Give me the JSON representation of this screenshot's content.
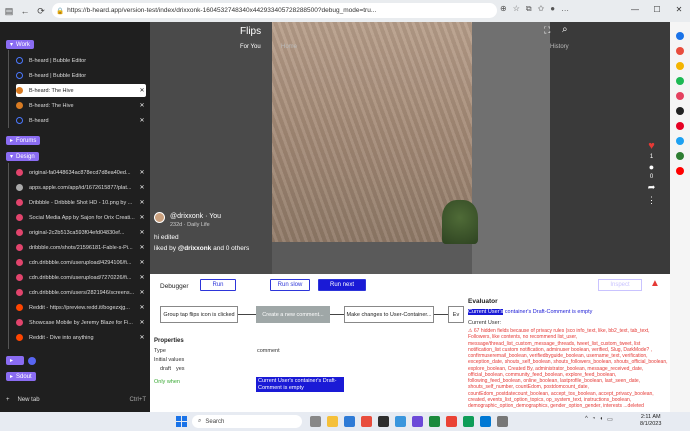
{
  "browser": {
    "url": "https://b-heard.app/version-test/index/drixxonk-1604532748340x442933405728288500?debug_mode=tru..."
  },
  "sidebar": {
    "groups": [
      {
        "label": "Work",
        "color": "#8a6cf2"
      },
      {
        "label": "Forums",
        "color": "#8a6cf2"
      },
      {
        "label": "Design",
        "color": "#8a6cf2"
      },
      {
        "label": "Sdout",
        "color": "#8a6cf2"
      }
    ],
    "work_tabs": [
      {
        "label": "B-heard | Bubble Editor"
      },
      {
        "label": "B-heard | Bubble Editor"
      },
      {
        "label": "B-heard: The Hive",
        "active": true
      },
      {
        "label": "B-heard: The Hive"
      },
      {
        "label": "B-heard"
      }
    ],
    "design_tabs": [
      {
        "label": "original-fa0448634ac878ecd7d8ea40ed..."
      },
      {
        "label": "apps.apple.com/app/id/1672615877/plat..."
      },
      {
        "label": "Dribbble - Dribbble Shot HD - 10.png by ..."
      },
      {
        "label": "Social Media App by Sajon for Orix Creati..."
      },
      {
        "label": "original-2c2b513ca593f04efd04830ef..."
      },
      {
        "label": "dribbble.com/shots/21596181-Fable-s-Pi..."
      },
      {
        "label": "cdn.dribbble.com/userupload/4294106/fi..."
      },
      {
        "label": "cdn.dribbble.com/userupload/7270226/fi..."
      },
      {
        "label": "cdn.dribbble.com/users/2821946/screens..."
      },
      {
        "label": "Reddit - https://preview.redd.it/bogezxjg..."
      },
      {
        "label": "Showcase Mobile by Jeremy Blaze for Fi..."
      },
      {
        "label": "Reddit - Dive into anything"
      }
    ],
    "new_tab": {
      "label": "New tab",
      "shortcut": "Ctrl+T"
    }
  },
  "video": {
    "title": "Flips",
    "tabs": {
      "for_you": "For You",
      "home": "Home",
      "history": "History"
    },
    "user": "@drixxonk · You",
    "sub": "232d · Daily Life",
    "caption": "hi edited",
    "liked_prefix": "liked by ",
    "liked_user": "@drixxonk",
    "liked_suffix": " and 0 others",
    "like_count": "1",
    "comment_count": "0"
  },
  "debugger": {
    "title": "Debugger",
    "run": "Run",
    "run_slow": "Run slow",
    "run_next": "Run next",
    "inspect": "Inspect",
    "steps": [
      "Group tap flips icon is clicked",
      "Create a new comment...",
      "Make changes to User-Container...",
      "Ev"
    ],
    "properties_title": "Properties",
    "type_label": "Type",
    "type_value": "comment",
    "initial_values": "Initial values",
    "draft_label": "draft",
    "draft_value": "yes",
    "only_when": "Only when",
    "condition": "Current User's container's Draft-Comment is empty",
    "evaluator_title": "Evaluator",
    "eval_highlight": "Current User's",
    "eval_rest": " container's Draft-Comment is empty",
    "current_user": "Current User:",
    "eval_detail": "⚠ 67 hidden fields because of privacy rules (sco info_text, like, bb2_text, tab_text, Followers, like contents, no recommend list_user, message/thread_list_custom_message_threads, tweet_list_custom_tweet, list notification_list custom notification, adminuser boolean, verified, Slug, DarkMode? , confirmuseremail_boolean, verifiedbyguide_boolean, username_text, verification, exception_date, shouts_self_boolean, shouts_followers_boolean, shouts_official_boolean, explore_boolean, Created By, administrator_boolean, message_received_date, official_boolean, community_feed_boolean, explore_feed_boolean, following_feed_boolean, online_boolean, lastprofile_boolean, last_seen_date, shouts_self_number, countEdom, postdomcount_date, countEdom_postdatecount_boolean, accept_tos_boolean, accept_privacy_boolean, created, events_list_option_topics, op_system_text, instructions_boolean, demographic_option_demographics, gender_option_gender, interests ...deleted"
  },
  "taskbar": {
    "search": "Search",
    "time": "2:11 AM",
    "date": "8/1/2023"
  }
}
